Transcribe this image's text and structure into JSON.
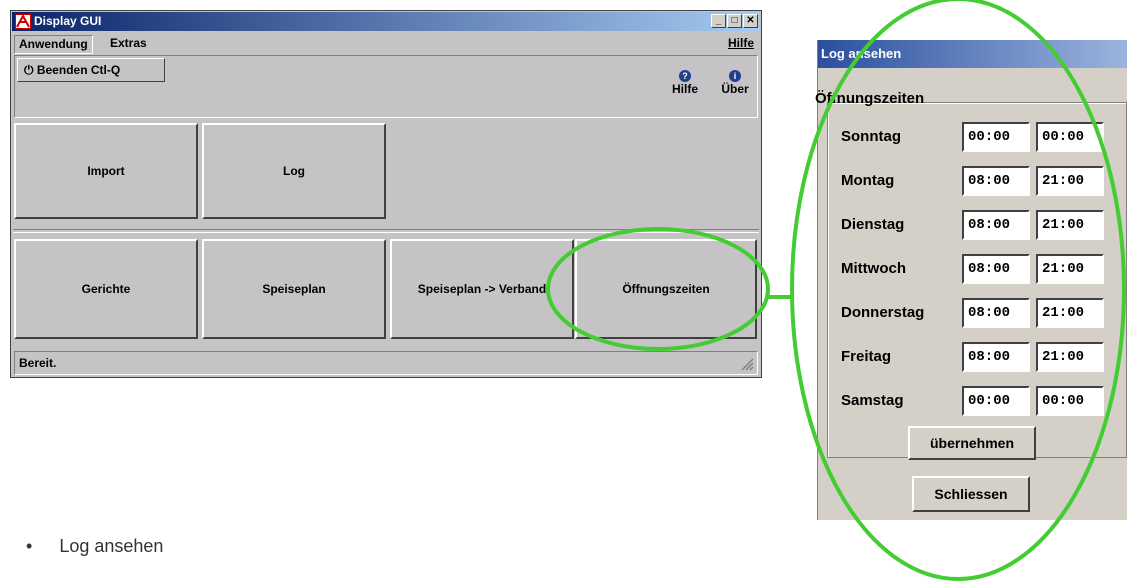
{
  "window": {
    "title": "Display GUI",
    "controls": {
      "minimize": "_",
      "maximize": "□",
      "close": "✕"
    },
    "menus": [
      "Anwendung",
      "Extras",
      "Hilfe"
    ],
    "toolbar": {
      "quit_label": "Beenden Ctl-Q",
      "help_label": "Hilfe",
      "about_label": "Über",
      "help_icon": "?",
      "about_icon": "i"
    },
    "buttons_row1": [
      "Import",
      "Log"
    ],
    "buttons_row2": [
      "Gerichte",
      "Speiseplan",
      "Speiseplan -> Verband",
      "Öffnungszeiten"
    ],
    "status": "Bereit."
  },
  "dialog": {
    "title": "Log ansehen",
    "group_label": "Öffnungszeiten",
    "days": [
      {
        "day": "Sonntag",
        "open": "00:00",
        "close": "00:00"
      },
      {
        "day": "Montag",
        "open": "08:00",
        "close": "21:00"
      },
      {
        "day": "Dienstag",
        "open": "08:00",
        "close": "21:00"
      },
      {
        "day": "Mittwoch",
        "open": "08:00",
        "close": "21:00"
      },
      {
        "day": "Donnerstag",
        "open": "08:00",
        "close": "21:00"
      },
      {
        "day": "Freitag",
        "open": "08:00",
        "close": "21:00"
      },
      {
        "day": "Samstag",
        "open": "00:00",
        "close": "00:00"
      }
    ],
    "apply_label": "übernehmen",
    "close_label": "Schliessen"
  },
  "caption": {
    "bullet": "•",
    "text": "Log ansehen"
  },
  "colors": {
    "highlight_ellipse": "#44cc33",
    "title_blue": "#0a246a"
  }
}
